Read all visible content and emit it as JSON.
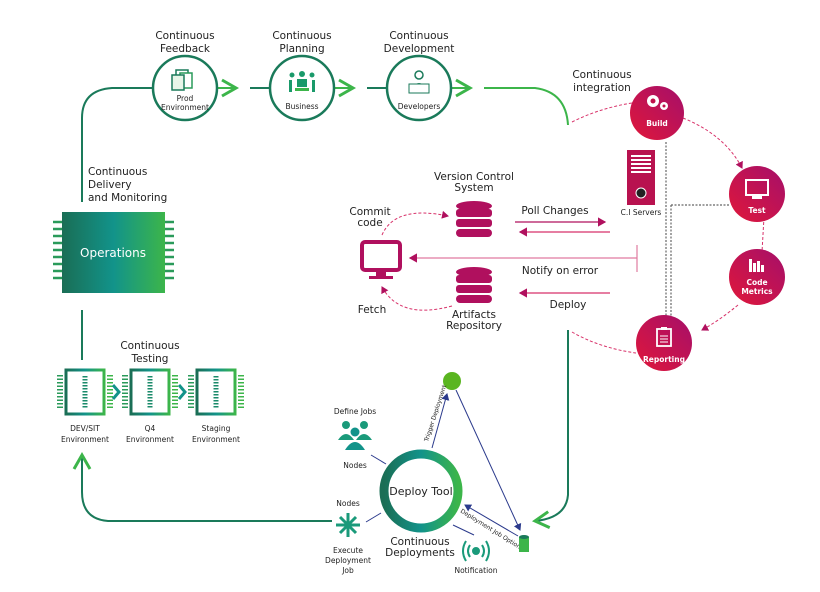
{
  "colors": {
    "green_dark": "#1a7a5a",
    "green_light": "#3cb54a",
    "magenta": "#b0105e",
    "red": "#e0173a",
    "navy": "#2b3a8c",
    "gray": "#666666"
  },
  "top": {
    "feedback": {
      "title1": "Continuous",
      "title2": "Feedback",
      "label1": "Prod",
      "label2": "Environment",
      "icon": "documents-icon"
    },
    "planning": {
      "title1": "Continuous",
      "title2": "Planning",
      "label": "Business",
      "icon": "meeting-icon"
    },
    "development": {
      "title1": "Continuous",
      "title2": "Development",
      "label": "Developers",
      "icon": "developer-laptop-icon"
    }
  },
  "ci": {
    "title1": "Continuous",
    "title2": "integration",
    "stages": [
      {
        "label": "Build",
        "icon": "gears-icon"
      },
      {
        "label": "Test",
        "icon": "monitor-icon"
      },
      {
        "label1": "Code",
        "label2": "Metrics",
        "icon": "bar-chart-icon"
      },
      {
        "label": "Reporting",
        "icon": "clipboard-icon"
      }
    ],
    "servers_label": "C.I Servers"
  },
  "delivery": {
    "line1": "Continuous",
    "line2": "Delivery",
    "line3": "and Monitoring",
    "operations": "Operations"
  },
  "testing": {
    "title1": "Continuous",
    "title2": "Testing",
    "envs": [
      {
        "l1": "DEV/SIT",
        "l2": "Environment"
      },
      {
        "l1": "Q4",
        "l2": "Environment"
      },
      {
        "l1": "Staging",
        "l2": "Environment"
      }
    ]
  },
  "vcs": {
    "vcs1": "Version Control",
    "vcs2": "System",
    "commit1": "Commit",
    "commit2": "code",
    "poll": "Poll Changes",
    "notify": "Notify on error",
    "deploy": "Deploy",
    "fetch": "Fetch",
    "art1": "Artifacts",
    "art2": "Repository"
  },
  "deploy": {
    "tool": "Deploy Tool",
    "cd1": "Continuous",
    "cd2": "Deployments",
    "define_jobs": "Define Jobs",
    "nodes1": "Nodes",
    "nodes2": "Nodes",
    "exec1": "Execute",
    "exec2": "Deployment",
    "exec3": "Job",
    "notification": "Notification",
    "trigger": "Trigger Deployment",
    "job_options": "Deployment Job Options"
  }
}
